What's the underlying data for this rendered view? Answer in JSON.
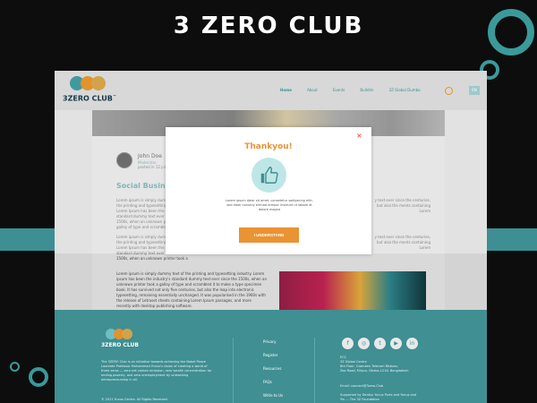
{
  "promo": {
    "title": "3 ZERO CLUB"
  },
  "brand": {
    "logo_text": "3ZERO CLUB",
    "trademark": "™",
    "colors": {
      "teal": "#3f8f93",
      "orange": "#ea9333",
      "dark": "#17394a"
    }
  },
  "nav": {
    "items": [
      "Home",
      "About",
      "Events",
      "Bulletin",
      "3Z Global Dumbo"
    ],
    "lang": "EN"
  },
  "article": {
    "author_name": "John Doe",
    "author_role": "Moderator",
    "author_date": "posted in 12 july",
    "heading": "Social Business",
    "p1": "Lorem ipsum is simply dummy text of the printing and typesetting industry. Lorem Ipsum has been the industry's standard dummy text ever since the 1500s, when an unknown printer took a galley of type and scrambled it to make a type specimen book. It has survived not only five centuries, but also the leap into electronic typesetting.",
    "p1_right": "y text ever since the centuries, but also the ments containing Lorem",
    "p2": "Lorem ipsum is simply dummy text of the printing and typesetting industry. Lorem Ipsum has been the industry's standard dummy text ever since the 1500s, when an unknown printer took a galley of type.",
    "p2_right": "y text ever since the centuries, but also the ments containing Lorem",
    "p3": "Lorem ipsum is simply dummy text of the printing and typesetting industry. Lorem ipsum has been the industry's standard dummy text ever since the 1500s, when an unknown printer took a galley of type and scrambled it to make a type specimen book. It has survived not only five centuries, but also the leap into electronic typesetting, remaining essentially unchanged. It was popularised in the 1960s with the release of Letraset sheets containing Lorem Ipsum passages, and more recently with desktop publishing software."
  },
  "modal": {
    "title": "Thankyou!",
    "message": "Lorem ipsum dolor sit amet, consetetur sadipscing elitr, sed diam nonumy eirmod tempor invidunt ut labore et dolore magna",
    "button": "I UNDERSTAND",
    "close": "×",
    "icon": "thumbs-up-icon"
  },
  "footer": {
    "logo_text": "3ZERO CLUB",
    "description": "The 3ZERO Club is an initiative towards achieving the Nobel Peace Laureate Professor Muhammad Yunus's vision of creating a world of three zeros — zero net carbon emission, zero wealth concentration for ending poverty, and zero unemployment by unleashing entrepreneurship in all.",
    "copyright": "© 2021 Yunus Centre. All Rights Reserved.",
    "links": [
      "Privacy",
      "Register",
      "Resources",
      "FAQs",
      "Write to Us"
    ],
    "social": [
      "f",
      "◎",
      "t",
      "▶",
      "in"
    ],
    "address": "ECC\n3Z Global Centre\n6th Floor, Grameen Telecom Bhaban,\nZoo Road, Mirpur, Dhaka-1216, Bangladesh",
    "email": "Email: connect@3zero.Club",
    "support": "Supported by Dentsu Yunus Ports and Yunus and Yiu — The 3Z Foundation"
  }
}
